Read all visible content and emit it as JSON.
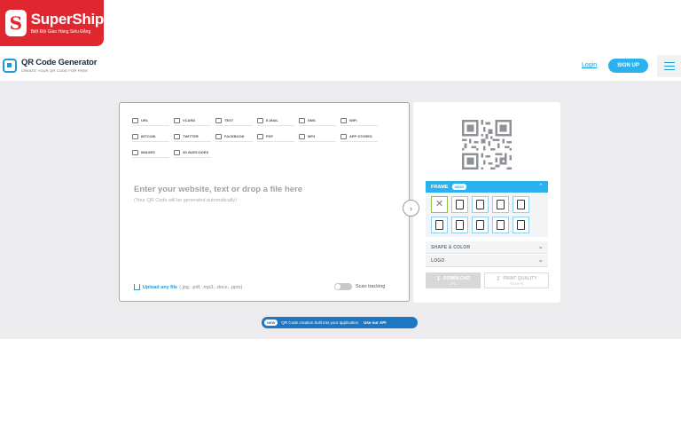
{
  "overlay": {
    "brand": "SuperShip",
    "tagline": "Biệt Đội Giao Hàng Siêu Đẳng",
    "logo_letter": "S"
  },
  "header": {
    "title": "QR Code Generator",
    "subtitle": "CREATE YOUR QR CODE FOR FREE",
    "login": "Login",
    "signup": "SIGN UP"
  },
  "types": [
    {
      "label": "URL",
      "icon": "link-icon"
    },
    {
      "label": "VCARD",
      "icon": "vcard-icon"
    },
    {
      "label": "TEXT",
      "icon": "text-icon"
    },
    {
      "label": "E-MAIL",
      "icon": "email-icon"
    },
    {
      "label": "SMS",
      "icon": "sms-icon"
    },
    {
      "label": "WIFI",
      "icon": "wifi-icon"
    },
    {
      "label": "BITCOIN",
      "icon": "bitcoin-icon"
    },
    {
      "label": "TWITTER",
      "icon": "twitter-icon"
    },
    {
      "label": "FACEBOOK",
      "icon": "facebook-icon"
    },
    {
      "label": "PDF",
      "icon": "pdf-icon"
    },
    {
      "label": "MP3",
      "icon": "music-icon"
    },
    {
      "label": "APP STORES",
      "icon": "app-store-icon"
    },
    {
      "label": "IMAGES",
      "icon": "image-icon"
    },
    {
      "label": "2D BARCODES",
      "icon": "barcode-icon"
    }
  ],
  "editor": {
    "prompt": "Enter your website, text or drop a file here",
    "hint": "(Your QR Code will be generated automatically)",
    "upload_link": "Upload any file",
    "upload_types": "(.jpg, .pdf, .mp3, .docx, .pptx)",
    "scan_tracking": "Scan tracking"
  },
  "sidebar": {
    "frame_title": "FRAME",
    "frame_badge": "NEW!",
    "shape_color": "SHAPE & COLOR",
    "logo": "LOGO",
    "download": "DOWNLOAD",
    "download_sub": "JPG",
    "print_quality": "PRINT QUALITY",
    "print_sub": "SVG/EPS"
  },
  "api_banner": {
    "badge": "NEW",
    "text": "QR Code creation built into your application",
    "link": "Use our API"
  },
  "colors": {
    "accent": "#2ab1ee",
    "brand_red": "#e0262f",
    "api_blue": "#1d78c4"
  }
}
